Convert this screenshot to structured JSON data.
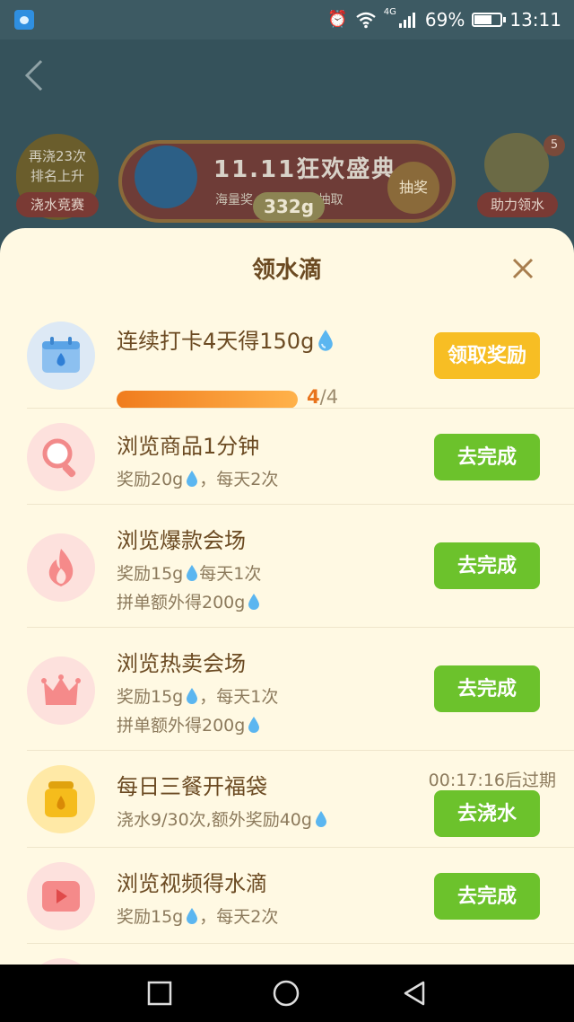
{
  "status_bar": {
    "network": "4G",
    "battery": "69%",
    "time": "13:11",
    "battery_level": 0.69
  },
  "background": {
    "left_badge_line1": "再浇23次",
    "left_badge_line2": "排名上升",
    "left_badge_label": "浇水竞赛",
    "banner_title": "11.11狂欢盛典",
    "banner_sub_left": "海量奖",
    "banner_sub_right": "前往抽取",
    "banner_draw": "抽奖",
    "weight": "332g",
    "right_badge": "5",
    "right_label": "助力领水"
  },
  "sheet": {
    "title": "领水滴",
    "tasks": [
      {
        "title": "连续打卡4天得150g",
        "progress_current": "4",
        "progress_sep": "/",
        "progress_total": "4",
        "progress_fraction": 1.0,
        "button": "领取奖励",
        "icon": "calendar-icon"
      },
      {
        "title": "浏览商品1分钟",
        "desc1_a": "奖励20g",
        "desc1_b": "，每天2次",
        "button": "去完成",
        "icon": "search-icon"
      },
      {
        "title": "浏览爆款会场",
        "desc1_a": "奖励15g",
        "desc1_b": "每天1次",
        "desc2": "拼单额外得200g",
        "button": "去完成",
        "icon": "fire-icon"
      },
      {
        "title": "浏览热卖会场",
        "desc1_a": "奖励15g",
        "desc1_b": "，每天1次",
        "desc2": "拼单额外得200g",
        "button": "去完成",
        "icon": "crown-icon"
      },
      {
        "title": "每日三餐开福袋",
        "desc1": "浇水9/30次,额外奖励40g",
        "expire": "00:17:16后过期",
        "button": "去浇水",
        "icon": "lucky-bag-icon"
      },
      {
        "title": "浏览视频得水滴",
        "desc1_a": "奖励15g",
        "desc1_b": "，每天2次",
        "button": "去完成",
        "icon": "video-play-icon"
      }
    ]
  },
  "colors": {
    "accent_green": "#6cc22c",
    "accent_yellow": "#f7be24",
    "title_brown": "#6b4a22",
    "sheet_bg": "#fff9e3"
  }
}
